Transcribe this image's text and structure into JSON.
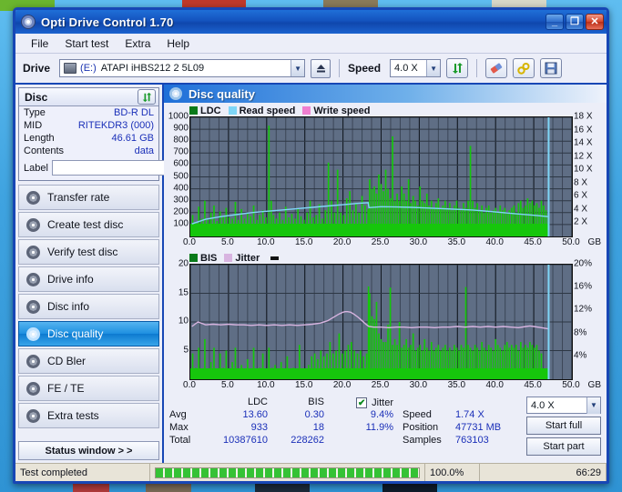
{
  "window": {
    "title": "Opti Drive Control 1.70",
    "app_icon": "disc-icon",
    "minimize_label": "_",
    "maximize_label": "❐",
    "close_label": "✕"
  },
  "menu": {
    "items": [
      "File",
      "Start test",
      "Extra",
      "Help"
    ]
  },
  "toolbar": {
    "drive_label": "Drive",
    "drive_value": "(E:)  ATAPI iHBS212  2 5L09",
    "drive_letter": "(E:)",
    "drive_name": "ATAPI iHBS212  2 5L09",
    "eject_icon": "eject-icon",
    "speed_label": "Speed",
    "speed_value": "4.0 X",
    "refresh_icon": "refresh-icon",
    "eraser_icon": "eraser-icon",
    "tools_icon": "tools-icon",
    "save_icon": "save-icon"
  },
  "sidebar": {
    "disc_panel_title": "Disc",
    "disc_refresh_icon": "refresh-icon",
    "disc_rows": [
      {
        "key": "Type",
        "value": "BD-R DL"
      },
      {
        "key": "MID",
        "value": "RITEKDR3 (000)"
      },
      {
        "key": "Length",
        "value": "46.61 GB"
      },
      {
        "key": "Contents",
        "value": "data"
      }
    ],
    "label_key": "Label",
    "label_value": "",
    "label_placeholder": "",
    "label_button_icon": "disc-icon",
    "nav_items": [
      {
        "label": "Transfer rate",
        "icon": "disc-transfer-icon",
        "active": false
      },
      {
        "label": "Create test disc",
        "icon": "disc-create-icon",
        "active": false
      },
      {
        "label": "Verify test disc",
        "icon": "disc-verify-icon",
        "active": false
      },
      {
        "label": "Drive info",
        "icon": "disc-drive-icon",
        "active": false
      },
      {
        "label": "Disc info",
        "icon": "disc-info-icon",
        "active": false
      },
      {
        "label": "Disc quality",
        "icon": "disc-quality-icon",
        "active": true
      },
      {
        "label": "CD Bler",
        "icon": "disc-bler-icon",
        "active": false
      },
      {
        "label": "FE / TE",
        "icon": "disc-fete-icon",
        "active": false
      },
      {
        "label": "Extra tests",
        "icon": "disc-extra-icon",
        "active": false
      }
    ],
    "status_window_label": "Status window > >"
  },
  "content": {
    "header_title": "Disc quality",
    "header_icon": "disc-quality-icon"
  },
  "stats": {
    "row_labels": [
      "Avg",
      "Max",
      "Total"
    ],
    "columns": [
      {
        "header": "LDC",
        "avg": "13.60",
        "max": "933",
        "total": "10387610"
      },
      {
        "header": "BIS",
        "avg": "0.30",
        "max": "18",
        "total": "228262"
      }
    ],
    "jitter": {
      "header": "Jitter",
      "checked": true,
      "check_glyph": "✔",
      "avg": "9.4%",
      "max": "11.9%"
    },
    "info": [
      {
        "key": "Speed",
        "value": "1.74 X"
      },
      {
        "key": "Position",
        "value": "47731 MB"
      },
      {
        "key": "Samples",
        "value": "763103"
      }
    ],
    "speed_select": "4.0 X",
    "start_full_label": "Start full",
    "start_part_label": "Start part"
  },
  "statusbar": {
    "message": "Test completed",
    "percent": "100.0%",
    "time": "66:29",
    "progress_value": 100
  },
  "chart_data": [
    {
      "id": "ldc-chart",
      "type": "line",
      "title": "",
      "xlabel": "GB",
      "ylabel": "LDC",
      "y2label": "X",
      "xlim": [
        0,
        50
      ],
      "ylim": [
        0,
        1000
      ],
      "y2lim": [
        0,
        18
      ],
      "grid": true,
      "legend_position": "top-left",
      "xticks": [
        0.0,
        5.0,
        10.0,
        15.0,
        20.0,
        25.0,
        30.0,
        35.0,
        40.0,
        45.0,
        50.0
      ],
      "xticklabels": [
        "0.0",
        "5.0",
        "10.0",
        "15.0",
        "20.0",
        "25.0",
        "30.0",
        "35.0",
        "40.0",
        "45.0",
        "50.0"
      ],
      "yticks": [
        100,
        200,
        300,
        400,
        500,
        600,
        700,
        800,
        900,
        1000
      ],
      "y2ticks": [
        2,
        4,
        6,
        8,
        10,
        12,
        14,
        16,
        18
      ],
      "y2ticklabels": [
        "2 X",
        "4 X",
        "6 X",
        "8 X",
        "10 X",
        "12 X",
        "14 X",
        "16 X",
        "18 X"
      ],
      "legend": [
        {
          "name": "LDC",
          "color": "#16c60c"
        },
        {
          "name": "Read speed",
          "color": "#7fd6f7"
        },
        {
          "name": "Write speed",
          "color": "#f07fd0"
        }
      ],
      "series": [
        {
          "name": "LDC",
          "color": "#16c60c",
          "kind": "bars",
          "x": [
            0.3,
            0.7,
            1.1,
            1.5,
            1.9,
            2.3,
            2.7,
            3.1,
            3.5,
            3.9,
            4.3,
            4.7,
            5.1,
            5.5,
            5.9,
            6.3,
            6.7,
            7.1,
            7.5,
            7.9,
            8.3,
            8.7,
            9.1,
            9.5,
            9.9,
            10.3,
            10.6,
            10.9,
            11.3,
            11.7,
            12.1,
            12.5,
            12.9,
            13.3,
            13.7,
            14.1,
            14.5,
            14.9,
            15.3,
            15.7,
            16.1,
            16.5,
            16.9,
            17.3,
            17.7,
            18.1,
            18.5,
            18.9,
            19.3,
            19.7,
            20.1,
            20.5,
            20.9,
            21.3,
            21.7,
            22.1,
            22.5,
            22.9,
            23.3,
            23.5,
            23.8,
            24.1,
            24.4,
            24.7,
            25.0,
            25.3,
            25.6,
            25.9,
            26.2,
            26.5,
            26.8,
            27.1,
            27.4,
            27.7,
            28.0,
            28.3,
            28.6,
            28.9,
            29.2,
            29.5,
            29.8,
            30.1,
            30.4,
            30.7,
            31.0,
            31.3,
            31.6,
            31.9,
            32.2,
            32.5,
            32.8,
            33.1,
            33.4,
            33.7,
            34.0,
            34.3,
            34.6,
            34.9,
            35.2,
            35.5,
            35.8,
            36.1,
            36.4,
            36.7,
            37.0,
            37.3,
            37.6,
            37.9,
            38.2,
            38.5,
            38.8,
            39.1,
            39.4,
            39.7,
            40.0,
            40.3,
            40.6,
            40.9,
            41.2,
            41.5,
            41.8,
            42.1,
            42.4,
            42.7,
            43.0,
            43.3,
            43.6,
            43.9,
            44.2,
            44.5,
            44.8,
            45.1,
            45.4,
            45.7,
            46.0,
            46.3,
            46.6,
            46.9
          ],
          "values": [
            180,
            120,
            250,
            150,
            300,
            140,
            200,
            260,
            130,
            210,
            170,
            240,
            160,
            150,
            290,
            140,
            230,
            150,
            200,
            170,
            260,
            140,
            180,
            220,
            160,
            930,
            300,
            180,
            150,
            200,
            140,
            250,
            160,
            190,
            150,
            230,
            170,
            140,
            200,
            300,
            160,
            180,
            270,
            150,
            220,
            620,
            300,
            200,
            560,
            200,
            180,
            320,
            380,
            220,
            280,
            200,
            340,
            260,
            230,
            480,
            400,
            420,
            360,
            520,
            440,
            380,
            560,
            400,
            320,
            840,
            300,
            360,
            300,
            420,
            360,
            300,
            480,
            280,
            340,
            300,
            260,
            420,
            300,
            280,
            360,
            260,
            300,
            240,
            280,
            320,
            240,
            260,
            300,
            240,
            280,
            220,
            260,
            300,
            240,
            220,
            280,
            240,
            300,
            760,
            300,
            240,
            280,
            220,
            260,
            200,
            240,
            260,
            200,
            220,
            240,
            200,
            260,
            220,
            240,
            200,
            220,
            240,
            260,
            200,
            280,
            300,
            240,
            260,
            320,
            280,
            300,
            260,
            280,
            240,
            300,
            260,
            220,
            180
          ]
        },
        {
          "name": "Read speed",
          "color": "#7fd6f7",
          "kind": "line",
          "x": [
            0.2,
            2,
            4,
            6,
            8,
            10,
            12,
            14,
            16,
            18,
            20,
            22,
            23.3,
            23.4,
            25,
            27,
            29,
            31,
            33,
            35,
            37,
            39,
            41,
            43,
            45,
            46.9
          ],
          "values": [
            1.9,
            2.6,
            3.0,
            3.3,
            3.6,
            3.8,
            4.0,
            4.2,
            4.4,
            4.6,
            4.8,
            5.0,
            5.1,
            4.35,
            4.5,
            4.45,
            4.4,
            4.3,
            4.2,
            4.1,
            4.0,
            3.8,
            3.6,
            3.4,
            3.2,
            3.0
          ]
        },
        {
          "name": "Write speed",
          "color": "#f07fd0",
          "kind": "line",
          "x": [],
          "values": []
        },
        {
          "name": "Layer break marker",
          "color": "#7fd6f7",
          "kind": "vline",
          "x": [
            46.95
          ],
          "values": []
        }
      ]
    },
    {
      "id": "bis-jitter-chart",
      "type": "line",
      "title": "",
      "xlabel": "GB",
      "ylabel": "BIS",
      "y2label": "%",
      "xlim": [
        0,
        50
      ],
      "ylim": [
        0,
        20
      ],
      "y2lim": [
        0,
        20
      ],
      "grid": true,
      "legend_position": "top-left",
      "xticks": [
        0.0,
        5.0,
        10.0,
        15.0,
        20.0,
        25.0,
        30.0,
        35.0,
        40.0,
        45.0,
        50.0
      ],
      "xticklabels": [
        "0.0",
        "5.0",
        "10.0",
        "15.0",
        "20.0",
        "25.0",
        "30.0",
        "35.0",
        "40.0",
        "45.0",
        "50.0"
      ],
      "yticks": [
        5,
        10,
        15,
        20
      ],
      "y2ticks": [
        4,
        8,
        12,
        16,
        20
      ],
      "y2ticklabels": [
        "4%",
        "8%",
        "12%",
        "16%",
        "20%"
      ],
      "legend": [
        {
          "name": "BIS",
          "color": "#0a7a1a"
        },
        {
          "name": "Jitter",
          "color": "#d8b4e0"
        }
      ],
      "series": [
        {
          "name": "BIS",
          "color": "#16c60c",
          "kind": "bars",
          "x": [
            0.3,
            0.7,
            1.1,
            1.5,
            1.9,
            2.3,
            2.7,
            3.1,
            3.5,
            3.9,
            4.3,
            4.7,
            5.1,
            5.5,
            5.9,
            6.3,
            6.7,
            7.1,
            7.5,
            7.9,
            8.3,
            8.7,
            9.1,
            9.5,
            9.9,
            10.3,
            10.7,
            11.1,
            11.5,
            11.9,
            12.3,
            12.7,
            13.1,
            13.5,
            13.9,
            14.3,
            14.7,
            15.1,
            15.5,
            15.9,
            16.3,
            16.7,
            17.1,
            17.5,
            17.9,
            18.3,
            18.7,
            19.1,
            19.5,
            19.9,
            20.3,
            20.7,
            21.1,
            21.5,
            21.9,
            22.3,
            22.7,
            23.1,
            23.35,
            23.5,
            23.8,
            24.1,
            24.4,
            24.7,
            25.0,
            25.3,
            25.6,
            25.9,
            26.2,
            26.5,
            26.8,
            27.1,
            27.4,
            27.7,
            28.0,
            28.3,
            28.6,
            28.9,
            29.2,
            29.5,
            29.8,
            30.1,
            30.4,
            30.7,
            31.0,
            31.3,
            31.6,
            31.9,
            32.2,
            32.5,
            32.8,
            33.1,
            33.4,
            33.7,
            34.0,
            34.3,
            34.6,
            34.9,
            35.2,
            35.5,
            35.8,
            36.1,
            36.4,
            36.7,
            37.0,
            37.3,
            37.6,
            37.9,
            38.2,
            38.5,
            38.8,
            39.1,
            39.4,
            39.7,
            40.0,
            40.3,
            40.6,
            40.9,
            41.2,
            41.5,
            41.8,
            42.1,
            42.4,
            42.7,
            43.0,
            43.3,
            43.6,
            43.9,
            44.2,
            44.5,
            44.8,
            45.1,
            45.4,
            45.7,
            46.0,
            46.3,
            46.6,
            46.9
          ],
          "values": [
            4.5,
            2.0,
            5.5,
            1.5,
            7.0,
            1.2,
            3.0,
            5.5,
            1.2,
            4.5,
            2.0,
            5.0,
            1.5,
            3.0,
            5.5,
            1.2,
            2.5,
            1.5,
            3.5,
            1.2,
            5.5,
            1.5,
            2.0,
            4.5,
            1.5,
            5.5,
            2.0,
            2.5,
            1.5,
            3.0,
            1.2,
            4.0,
            1.5,
            2.0,
            1.5,
            6.0,
            1.5,
            1.2,
            2.5,
            4.0,
            4.5,
            3.5,
            5.0,
            4.0,
            4.5,
            6.5,
            4.5,
            5.0,
            8.0,
            4.5,
            5.0,
            6.0,
            6.5,
            5.0,
            4.5,
            5.0,
            4.0,
            4.5,
            16.2,
            15.0,
            11.0,
            10.5,
            13.5,
            8.0,
            7.0,
            6.5,
            6.5,
            9.5,
            16.0,
            6.0,
            7.0,
            6.0,
            10.0,
            5.5,
            6.0,
            7.0,
            5.5,
            6.0,
            8.0,
            5.0,
            5.5,
            6.0,
            5.0,
            7.0,
            5.5,
            5.0,
            6.5,
            5.0,
            5.5,
            6.0,
            5.0,
            5.5,
            6.0,
            5.0,
            5.5,
            5.0,
            6.0,
            5.5,
            5.0,
            6.0,
            5.5,
            16.1,
            6.0,
            5.5,
            5.0,
            6.0,
            5.5,
            5.0,
            6.5,
            5.5,
            5.0,
            6.0,
            5.5,
            5.0,
            7.0,
            6.0,
            5.5,
            5.0,
            6.0,
            6.5,
            5.5,
            6.0,
            5.5,
            6.0,
            5.0,
            6.5,
            5.5,
            6.0,
            5.5,
            6.5,
            6.0,
            5.5,
            6.0,
            5.0,
            4.5
          ]
        },
        {
          "name": "Jitter",
          "color": "#d8b4e0",
          "kind": "line",
          "x": [
            0.2,
            1,
            2,
            3,
            4,
            5,
            6,
            7,
            8,
            9,
            10,
            11,
            12,
            13,
            14,
            15,
            16,
            17,
            18,
            18.5,
            19,
            19.5,
            20,
            20.3,
            20.6,
            21,
            21.5,
            22,
            22.5,
            23,
            23.3,
            23.4,
            24,
            25,
            26,
            27,
            28,
            29,
            30,
            31,
            32,
            33,
            34,
            35,
            36,
            37,
            38,
            39,
            40,
            41,
            42,
            43,
            44,
            44.5,
            45,
            46,
            46.9
          ],
          "values": [
            9.2,
            10.0,
            9.5,
            9.6,
            9.5,
            9.6,
            9.5,
            9.5,
            9.4,
            9.5,
            9.4,
            9.5,
            9.4,
            9.5,
            9.4,
            9.5,
            9.6,
            9.8,
            10.2,
            10.6,
            11.0,
            11.4,
            11.7,
            11.8,
            11.8,
            11.7,
            11.3,
            10.8,
            10.2,
            9.6,
            9.3,
            9.2,
            9.1,
            9.1,
            9.0,
            9.1,
            9.1,
            9.0,
            9.1,
            9.1,
            9.0,
            9.1,
            9.1,
            9.2,
            9.1,
            9.2,
            9.1,
            9.2,
            9.1,
            9.2,
            9.1,
            9.0,
            9.2,
            9.3,
            9.2,
            9.0,
            8.8
          ]
        },
        {
          "name": "Layer break marker",
          "color": "#7fd6f7",
          "kind": "vline",
          "x": [
            46.95
          ],
          "values": []
        }
      ]
    }
  ]
}
